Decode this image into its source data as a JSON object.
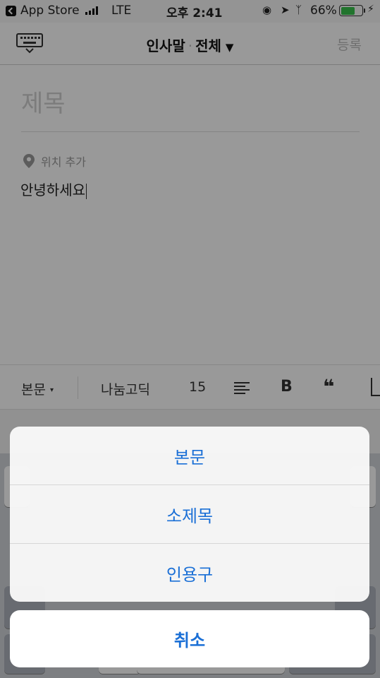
{
  "status_bar": {
    "back_app": "App Store",
    "network": "LTE",
    "time": "오후 2:41",
    "battery_percent": "66%",
    "battery_level": 0.66,
    "icons": [
      "back-icon",
      "signal-icon",
      "orientation-lock-icon",
      "location-icon",
      "bluetooth-icon",
      "battery-icon",
      "charging-icon"
    ]
  },
  "nav": {
    "title": "인사말",
    "separator": "·",
    "category": "전체",
    "category_caret": "▼",
    "action": "등록"
  },
  "editor": {
    "title_placeholder": "제목",
    "location_label": "위치 추가",
    "body": "안녕하세요"
  },
  "format_toolbar": {
    "style": "본문",
    "style_caret": "▾",
    "font": "나눔고딕",
    "size": "15",
    "bold": "B",
    "quote": "❝"
  },
  "action_sheet": {
    "options": [
      "본문",
      "소제목",
      "인용구"
    ],
    "cancel": "취소",
    "accent_color": "#1a6fd6"
  }
}
